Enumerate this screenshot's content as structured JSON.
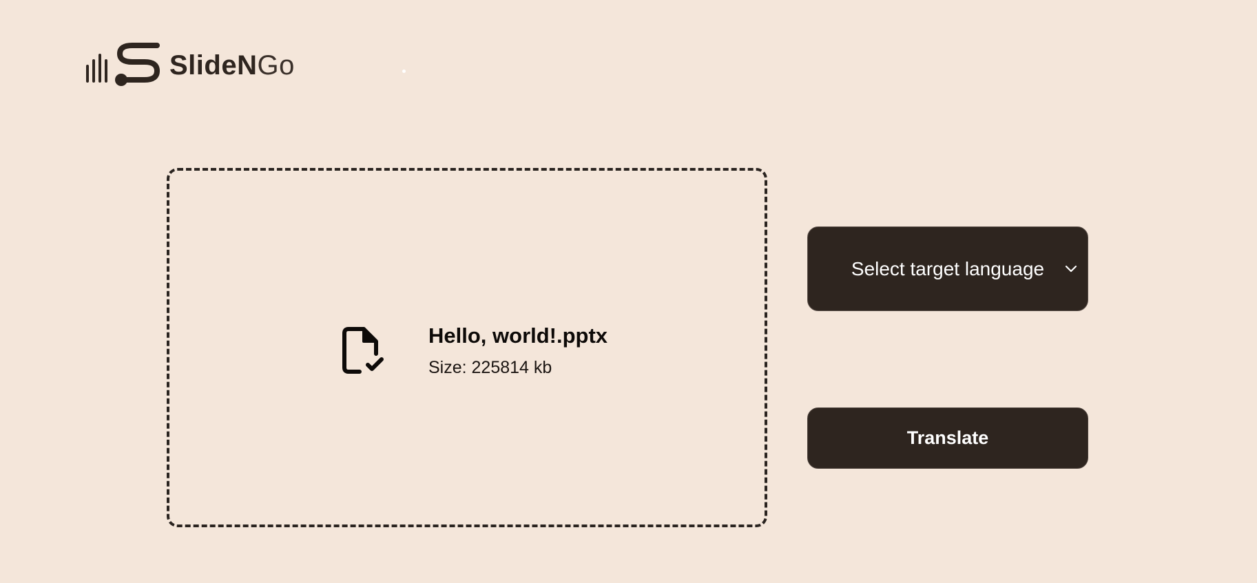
{
  "brand": {
    "name_bold": "SlideN",
    "name_light": "Go"
  },
  "upload": {
    "file_name": "Hello, world!.pptx",
    "file_size": "Size: 225814 kb"
  },
  "controls": {
    "language_select_label": "Select target language",
    "translate_label": "Translate"
  },
  "icons": {
    "logo": "slidengo-logo-icon",
    "file": "file-check-icon",
    "dropdown": "chevron-down-icon"
  },
  "colors": {
    "background": "#f4e6da",
    "dark": "#2e251f",
    "text_on_dark": "#ffffff"
  }
}
